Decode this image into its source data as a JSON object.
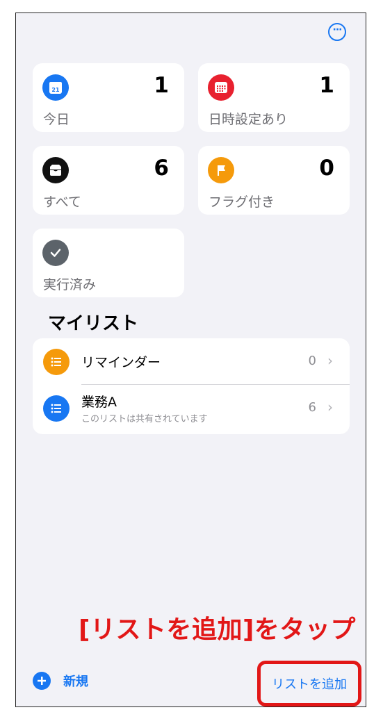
{
  "header": {
    "more_icon": "ellipsis-circle-icon"
  },
  "smart_lists": [
    {
      "id": "today",
      "label": "今日",
      "count": "1",
      "icon": "calendar-today-icon",
      "icon_text": "21",
      "color": "#1877f2"
    },
    {
      "id": "scheduled",
      "label": "日時設定あり",
      "count": "1",
      "icon": "calendar-scheduled-icon",
      "color": "#e8212f"
    },
    {
      "id": "all",
      "label": "すべて",
      "count": "6",
      "icon": "tray-icon",
      "color": "#111111"
    },
    {
      "id": "flagged",
      "label": "フラグ付き",
      "count": "0",
      "icon": "flag-icon",
      "color": "#f59a0b"
    },
    {
      "id": "completed",
      "label": "実行済み",
      "icon": "checkmark-icon",
      "color": "#5c636a"
    }
  ],
  "my_lists": {
    "title": "マイリスト",
    "items": [
      {
        "name": "リマインダー",
        "count": "0",
        "icon": "list-bullet-icon",
        "color": "#f59a0b"
      },
      {
        "name": "業務A",
        "subtitle": "このリストは共有されています",
        "count": "6",
        "icon": "list-bullet-icon",
        "color": "#1877f2"
      }
    ]
  },
  "annotation": "[リストを追加]をタップ",
  "toolbar": {
    "new_label": "新規",
    "add_list_label": "リストを追加"
  },
  "colors": {
    "accent": "#1877f2",
    "annotation": "#e21717",
    "background": "#f2f2f7"
  }
}
